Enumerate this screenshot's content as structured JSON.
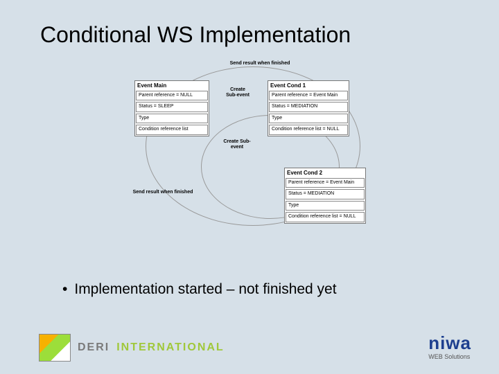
{
  "title": "Conditional WS Implementation",
  "connectors": {
    "top": "Send result when finished",
    "create_sub1": "Create\nSub-event",
    "create_sub2": "Create\nSub-event",
    "left": "Send result when finished"
  },
  "entities": {
    "main": {
      "header": "Event Main",
      "rows": [
        "Parent reference = NULL",
        "Status = SLEEP",
        "Type",
        "Condition reference list"
      ]
    },
    "cond1": {
      "header": "Event Cond 1",
      "rows": [
        "Parent reference = Event Main",
        "Status = MEDIATION",
        "Type",
        "Condition reference list = NULL"
      ]
    },
    "cond2": {
      "header": "Event Cond 2",
      "rows": [
        "Parent reference = Event Main",
        "Status = MEDIATION",
        "Type",
        "Condition reference list = NULL"
      ]
    }
  },
  "bullet": "Implementation started – not finished  yet",
  "footer": {
    "deri": "DERI",
    "intl": "INTERNATIONAL",
    "niwa": "niwa",
    "niwa_sub": "WEB Solutions"
  }
}
